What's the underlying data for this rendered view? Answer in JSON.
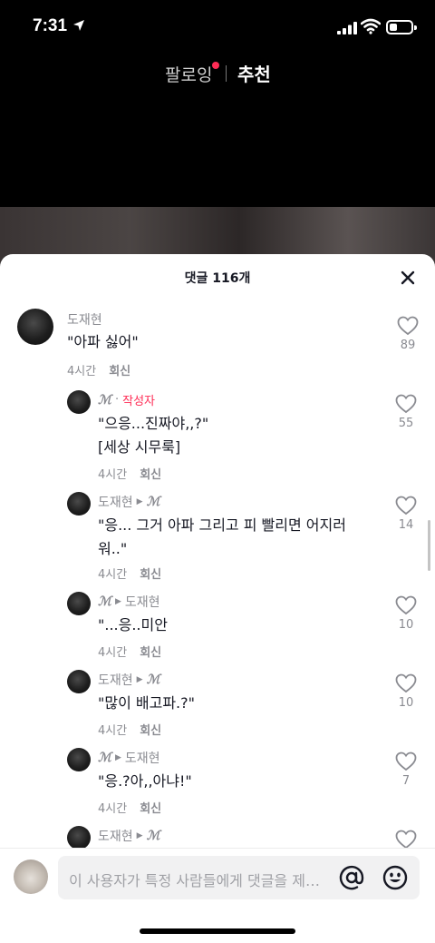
{
  "status": {
    "time": "7:31"
  },
  "top_tabs": {
    "following": "팔로잉",
    "for_you": "추천"
  },
  "sheet": {
    "title": "댓글 116개",
    "reply_label": "회신",
    "author_label": "작성자",
    "comments": [
      {
        "user": "도재현",
        "text": "\"아파 싫어\"",
        "time": "4시간",
        "likes": "89"
      },
      {
        "user": "ℳ",
        "text": "\"으응...진짜야,,?\"\n[세상 시무룩]",
        "time": "4시간",
        "likes": "55"
      },
      {
        "user": "도재현",
        "to": "ℳ",
        "text": "\"응... 그거 아파 그리고 피 빨리면 어지러\n워..\"",
        "time": "4시간",
        "likes": "14"
      },
      {
        "user": "ℳ",
        "to": "도재현",
        "text": "\"...응..미안",
        "time": "4시간",
        "likes": "10"
      },
      {
        "user": "도재현",
        "to": "ℳ",
        "text": "\"많이 배고파.?\"",
        "time": "4시간",
        "likes": "10"
      },
      {
        "user": "ℳ",
        "to": "도재현",
        "text": "\"응.?아,,아냐!\"",
        "time": "4시간",
        "likes": "7"
      },
      {
        "user": "도재현",
        "to": "ℳ"
      }
    ]
  },
  "input": {
    "placeholder": "이 사용자가 특정 사람들에게 댓글을 제한했습니다"
  },
  "colors": {
    "accent": "#fe2c55",
    "muted": "#8a8b91",
    "text": "#161823"
  }
}
